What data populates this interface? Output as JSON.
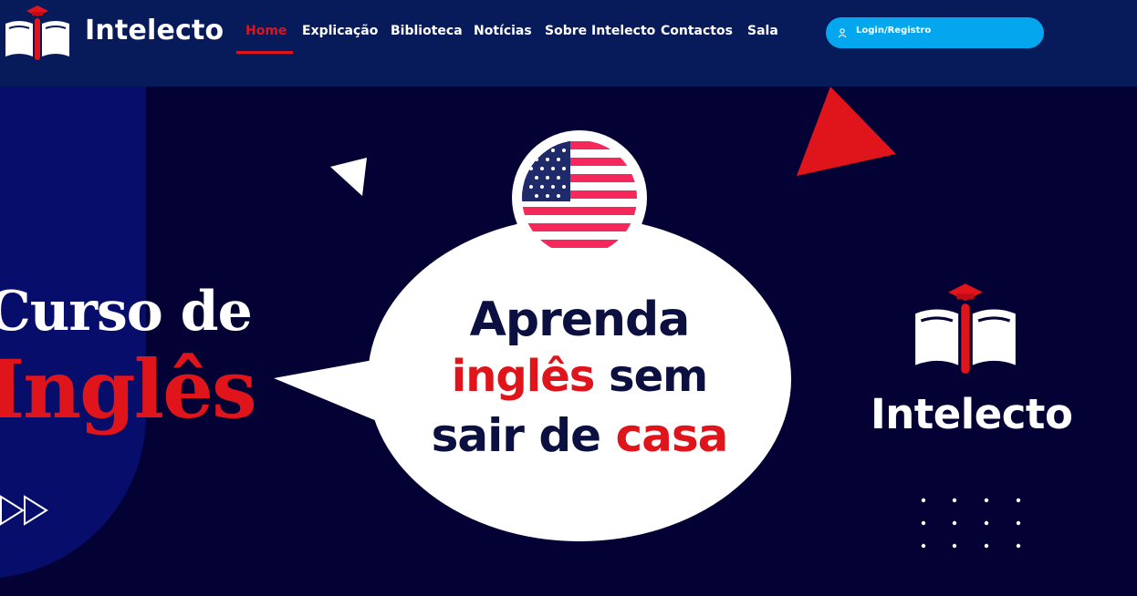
{
  "header": {
    "brand": "Intelecto",
    "nav": [
      {
        "label": "Home",
        "active": true
      },
      {
        "label": "Explicação",
        "active": false
      },
      {
        "label": "Biblioteca",
        "active": false
      },
      {
        "label": "Notícias",
        "active": false
      },
      {
        "label": "Sobre Intelecto",
        "active": false
      },
      {
        "label": "Contactos",
        "active": false
      },
      {
        "label": "Sala",
        "active": false
      }
    ],
    "login": {
      "label": "Login/Registro",
      "icon": "user-icon"
    }
  },
  "hero": {
    "left_line1": "Curso de",
    "left_line2": "Inglês",
    "bubble": {
      "line1": "Aprenda",
      "line2_red": "inglês",
      "line2_rest": " sem",
      "line3_start": "sair de ",
      "line3_red": "casa"
    },
    "brand": "Intelecto"
  },
  "colors": {
    "header_bg": "#071a5a",
    "hero_bg": "#040235",
    "accent_red": "#e0141b",
    "button_blue": "#04a6ee"
  },
  "icons": [
    "logo-book-icon",
    "user-icon",
    "flag-usa-icon",
    "play-forward-icon"
  ]
}
